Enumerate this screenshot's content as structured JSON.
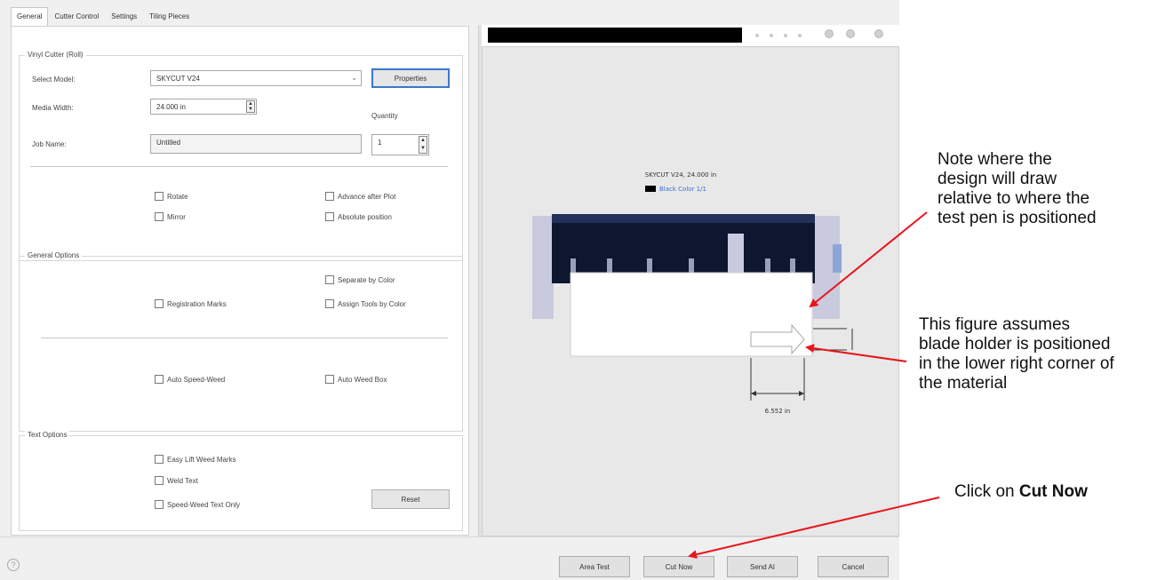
{
  "tabs": [
    "General",
    "Cutter Control",
    "Settings",
    "Tiling Pieces"
  ],
  "groups": {
    "vinyl_cutter": "Vinyl Cutter (Roll)",
    "general_options": "General Options",
    "text_options": "Text Options"
  },
  "vinyl": {
    "select_model_label": "Select Model:",
    "select_model_value": "SKYCUT V24",
    "properties_button": "Properties",
    "media_width_label": "Media Width:",
    "media_width_value": "24.000 in",
    "quantity_label": "Quantity",
    "quantity_value": "1",
    "job_name_label": "Job Name:",
    "job_name_value": "Untitled",
    "rotate": "Rotate",
    "mirror": "Mirror",
    "advance_after_plot": "Advance after Plot",
    "absolute_position": "Absolute position"
  },
  "general": {
    "separate_by_color": "Separate by Color",
    "registration_marks": "Registration Marks",
    "assign_tools_by_color": "Assign Tools by Color",
    "auto_speed_weed": "Auto Speed-Weed",
    "auto_weed_box": "Auto Weed Box"
  },
  "text": {
    "easy_lift_weed_marks": "Easy Lift Weed Marks",
    "weld_text": "Weld Text",
    "speed_weed_text_only": "Speed-Weed Text Only",
    "reset_button": "Reset"
  },
  "preview": {
    "machine_caption": "SKYCUT V24, 24.000 in",
    "color_legend": "Black Color 1/1",
    "dimension_label": "6.552 in"
  },
  "buttons": {
    "area_test": "Area Test",
    "cut_now": "Cut Now",
    "send_ai": "Send AI",
    "cancel": "Cancel"
  },
  "help_glyph": "?",
  "notes": {
    "note1_lines": [
      "Note where the",
      "design will draw",
      "relative to where the",
      "test pen is positioned"
    ],
    "note2_lines": [
      "This figure assumes",
      "blade holder is positioned",
      "in the lower right corner of",
      "the material"
    ],
    "note3_prefix": "Click on ",
    "note3_bold": "Cut Now"
  },
  "colors": {
    "arrow": "#e8141c",
    "focus": "#3b78c8",
    "machine_dark": "#0e1630",
    "machine_side": "#c9cadd"
  }
}
